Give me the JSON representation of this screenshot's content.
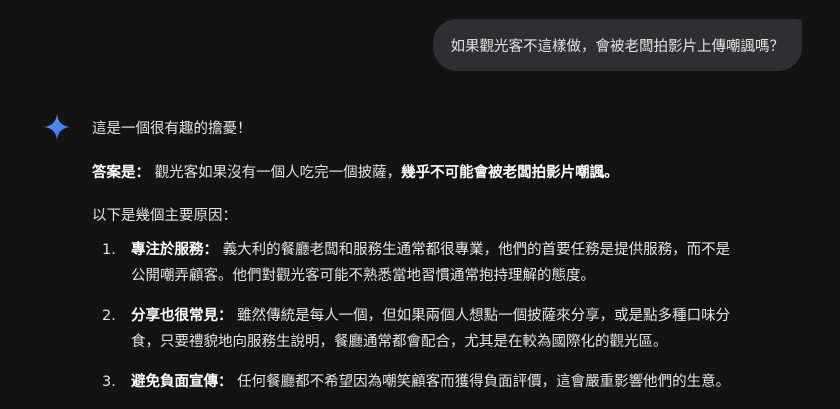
{
  "user_message": "如果觀光客不這樣做，會被老闆拍影片上傳嘲諷嗎？",
  "response": {
    "greeting": "這是一個很有趣的擔憂！",
    "answer_label": "答案是：",
    "answer_text": "觀光客如果沒有一個人吃完一個披薩，",
    "answer_emphasis": "幾乎不可能會被老闆拍影片嘲諷。",
    "reasons_intro": "以下是幾個主要原因：",
    "reasons": [
      {
        "number": "1.",
        "title": "專注於服務：",
        "text": "義大利的餐廳老闆和服務生通常都很專業，他們的首要任務是提供服務，而不是",
        "text_cont": "公開嘲弄顧客。他們對觀光客可能不熟悉當地習慣通常抱持理解的態度。"
      },
      {
        "number": "2.",
        "title": "分享也很常見：",
        "text": "雖然傳統是每人一個，但如果兩個人想點一個披薩來分享，或是點多種口味分",
        "text_cont": "食，只要禮貌地向服務生說明，餐廳通常都會配合，尤其是在較為國際化的觀光區。"
      },
      {
        "number": "3.",
        "title": "避免負面宣傳：",
        "text": "任何餐廳都不希望因為嘲笑顧客而獲得負面評價，這會嚴重影響他們的生意。"
      }
    ]
  },
  "colors": {
    "background": "#131314",
    "user_bubble": "#2f2f31",
    "text": "#e3e3e3",
    "gem_gradient_start": "#4f8df8",
    "gem_gradient_end": "#3b6fe0"
  },
  "icons": {
    "assistant": "sparkle-gem-icon"
  }
}
